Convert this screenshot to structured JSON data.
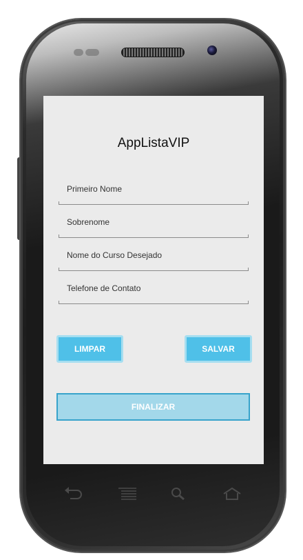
{
  "app": {
    "title": "AppListaVIP"
  },
  "form": {
    "fields": [
      {
        "label": "Primeiro Nome"
      },
      {
        "label": "Sobrenome"
      },
      {
        "label": "Nome do Curso Desejado"
      },
      {
        "label": "Telefone de Contato"
      }
    ]
  },
  "actions": {
    "clear_label": "LIMPAR",
    "save_label": "SALVAR",
    "finish_label": "FINALIZAR"
  },
  "nav_icons": [
    "back-icon",
    "menu-icon",
    "search-icon",
    "home-icon"
  ],
  "colors": {
    "accent": "#4fc0e8",
    "finish_bg": "#a3d8ea",
    "screen_bg": "#ebebeb"
  }
}
